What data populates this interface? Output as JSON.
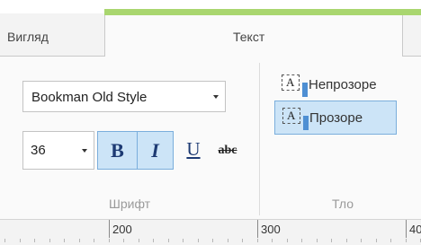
{
  "tabs": [
    {
      "label": "Вигляд"
    },
    {
      "label": "Текст"
    }
  ],
  "font_group": {
    "font_family": "Bookman Old Style",
    "font_size": "36",
    "bold_label": "B",
    "italic_label": "I",
    "underline_label": "U",
    "strike_label": "abc",
    "label": "Шрифт"
  },
  "background_group": {
    "opaque_label": "Непрозоре",
    "transparent_label": "Прозоре",
    "icon_glyph": "A",
    "label": "Тло"
  },
  "ruler": {
    "labels": [
      "200",
      "300",
      "40"
    ]
  },
  "colors": {
    "accent_green": "#a9d66f",
    "selected_fill": "#cce4f7",
    "selected_border": "#7aaedc"
  }
}
